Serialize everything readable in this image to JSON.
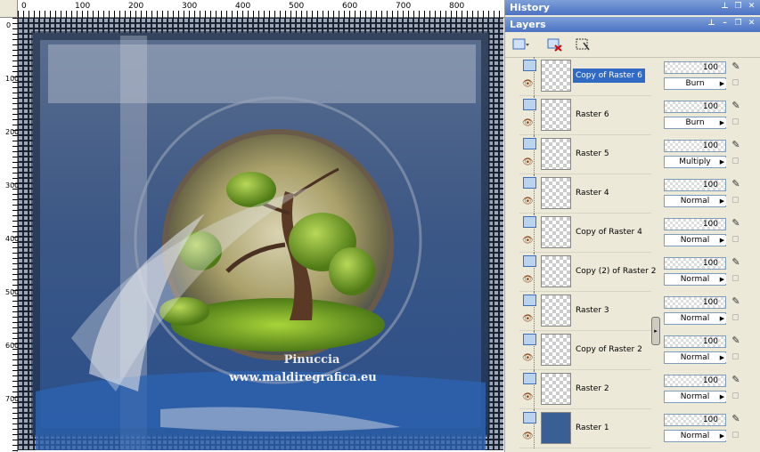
{
  "ruler": {
    "top_labels": [
      "0",
      "100",
      "200",
      "300",
      "400",
      "500",
      "600",
      "700",
      "800"
    ],
    "left_labels": [
      "0",
      "100",
      "200",
      "300",
      "400",
      "500",
      "600",
      "700"
    ]
  },
  "canvas": {
    "watermark_line1": "Pinuccia",
    "watermark_line2": "www.maldiregrafica.eu"
  },
  "history_panel": {
    "title": "History"
  },
  "layers_panel": {
    "title": "Layers",
    "toolbar": [
      "new-layer-icon",
      "delete-layer-icon",
      "mask-icon"
    ],
    "layers": [
      {
        "name": "Copy of Raster 6",
        "opacity": "100",
        "blend": "Burn",
        "selected": true
      },
      {
        "name": "Raster 6",
        "opacity": "100",
        "blend": "Burn",
        "selected": false
      },
      {
        "name": "Raster 5",
        "opacity": "100",
        "blend": "Multiply",
        "selected": false
      },
      {
        "name": "Raster 4",
        "opacity": "100",
        "blend": "Normal",
        "selected": false
      },
      {
        "name": "Copy of Raster 4",
        "opacity": "100",
        "blend": "Normal",
        "selected": false
      },
      {
        "name": "Copy (2) of Raster 2",
        "opacity": "100",
        "blend": "Normal",
        "selected": false
      },
      {
        "name": "Raster 3",
        "opacity": "100",
        "blend": "Normal",
        "selected": false
      },
      {
        "name": "Copy of Raster 2",
        "opacity": "100",
        "blend": "Normal",
        "selected": false
      },
      {
        "name": "Raster 2",
        "opacity": "100",
        "blend": "Normal",
        "selected": false
      },
      {
        "name": "Raster 1",
        "opacity": "100",
        "blend": "Normal",
        "selected": false
      }
    ]
  },
  "colors": {
    "title_bar": "#4a71c4",
    "selected": "#316ac5",
    "panel_bg": "#ece9d8"
  }
}
